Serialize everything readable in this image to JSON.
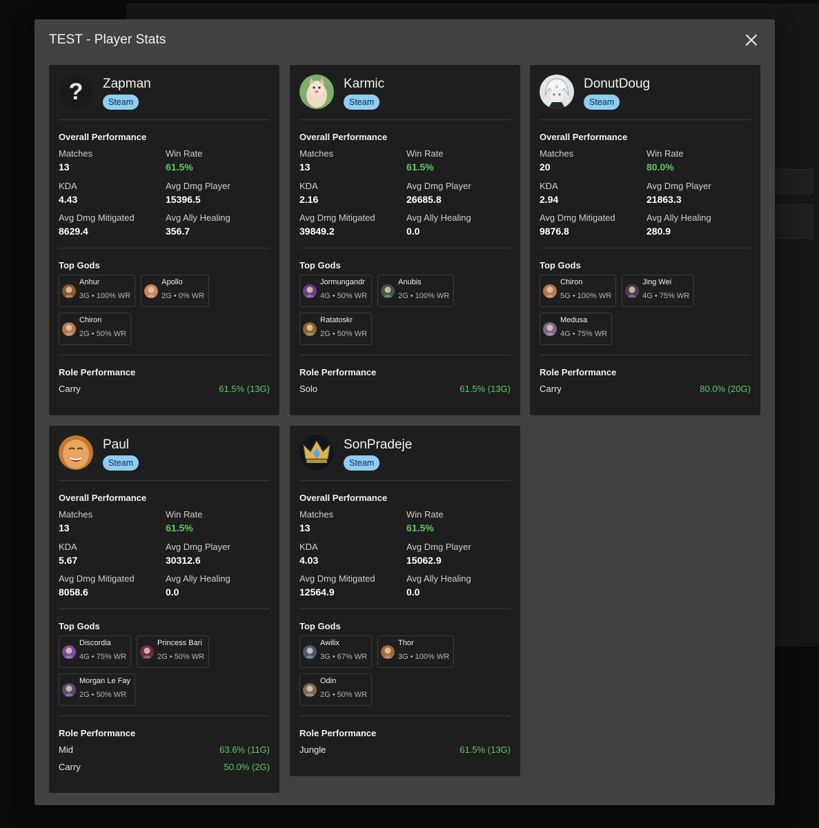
{
  "modal": {
    "title": "TEST - Player Stats"
  },
  "labels": {
    "overall": "Overall Performance",
    "matches": "Matches",
    "win_rate": "Win Rate",
    "kda": "KDA",
    "avg_dmg_player": "Avg Dmg Player",
    "avg_dmg_mitigated": "Avg Dmg Mitigated",
    "avg_ally_healing": "Avg Ally Healing",
    "top_gods": "Top Gods",
    "role_performance": "Role Performance"
  },
  "colors": {
    "win": "#5fc964",
    "badge": "#8fcdf5",
    "card": "#1e1e1e",
    "modal": "#424242"
  },
  "players": [
    {
      "name": "Zapman",
      "platform": "Steam",
      "avatar": "question-mark-icon",
      "matches": "13",
      "win_rate": "61.5%",
      "kda": "4.43",
      "avg_dmg_player": "15396.5",
      "avg_dmg_mitigated": "8629.4",
      "avg_ally_healing": "356.7",
      "gods": [
        {
          "name": "Anhur",
          "stat": "3G • 100% WR",
          "color": "#8a5a2a"
        },
        {
          "name": "Apollo",
          "stat": "2G • 0% WR",
          "color": "#c9865e"
        },
        {
          "name": "Chiron",
          "stat": "2G • 50% WR",
          "color": "#b47a4e"
        }
      ],
      "roles": [
        {
          "name": "Carry",
          "value": "61.5% (13G)"
        }
      ]
    },
    {
      "name": "Karmic",
      "platform": "Steam",
      "avatar": "cat-avatar-icon",
      "matches": "13",
      "win_rate": "61.5%",
      "kda": "2.16",
      "avg_dmg_player": "26685.8",
      "avg_dmg_mitigated": "39849.2",
      "avg_ally_healing": "0.0",
      "gods": [
        {
          "name": "Jormungandr",
          "stat": "4G • 50% WR",
          "color": "#6a3f8a"
        },
        {
          "name": "Anubis",
          "stat": "2G • 100% WR",
          "color": "#3a5a4a"
        },
        {
          "name": "Ratatoskr",
          "stat": "2G • 50% WR",
          "color": "#8a6a2a"
        }
      ],
      "roles": [
        {
          "name": "Solo",
          "value": "61.5% (13G)"
        }
      ]
    },
    {
      "name": "DonutDoug",
      "platform": "Steam",
      "avatar": "anime-avatar-icon",
      "matches": "20",
      "win_rate": "80.0%",
      "kda": "2.94",
      "avg_dmg_player": "21863.3",
      "avg_dmg_mitigated": "9876.8",
      "avg_ally_healing": "280.9",
      "gods": [
        {
          "name": "Chiron",
          "stat": "5G • 100% WR",
          "color": "#b47a4e"
        },
        {
          "name": "Jing Wei",
          "stat": "4G • 75% WR",
          "color": "#4a3a5a"
        },
        {
          "name": "Medusa",
          "stat": "4G • 75% WR",
          "color": "#7a6a8a"
        }
      ],
      "roles": [
        {
          "name": "Carry",
          "value": "80.0% (20G)"
        }
      ]
    },
    {
      "name": "Paul",
      "platform": "Steam",
      "avatar": "face-avatar-icon",
      "matches": "13",
      "win_rate": "61.5%",
      "kda": "5.67",
      "avg_dmg_player": "30312.6",
      "avg_dmg_mitigated": "8058.6",
      "avg_ally_healing": "0.0",
      "gods": [
        {
          "name": "Discordia",
          "stat": "4G • 75% WR",
          "color": "#7a4aa0"
        },
        {
          "name": "Princess Bari",
          "stat": "2G • 50% WR",
          "color": "#6a2a4a"
        },
        {
          "name": "Morgan Le Fay",
          "stat": "2G • 50% WR",
          "color": "#5a4a7a"
        }
      ],
      "roles": [
        {
          "name": "Mid",
          "value": "63.6% (11G)"
        },
        {
          "name": "Carry",
          "value": "50.0% (2G)"
        }
      ]
    },
    {
      "name": "SonPradeje",
      "platform": "Steam",
      "avatar": "crown-avatar-icon",
      "matches": "13",
      "win_rate": "61.5%",
      "kda": "4.03",
      "avg_dmg_player": "15062.9",
      "avg_dmg_mitigated": "12564.9",
      "avg_ally_healing": "0.0",
      "gods": [
        {
          "name": "Awilix",
          "stat": "3G • 67% WR",
          "color": "#4a5a7a"
        },
        {
          "name": "Thor",
          "stat": "3G • 100% WR",
          "color": "#a06a3a"
        },
        {
          "name": "Odin",
          "stat": "2G • 50% WR",
          "color": "#7a6a5a"
        }
      ],
      "roles": [
        {
          "name": "Jungle",
          "value": "61.5% (13G)"
        }
      ]
    }
  ]
}
